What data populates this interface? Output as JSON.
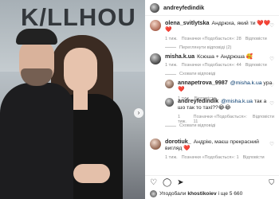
{
  "photo": {
    "sign_text": "K/LLHOU",
    "next_icon": "chevron-right-icon"
  },
  "post": {
    "author": "andreyfedindik"
  },
  "comments": [
    {
      "username": "olena_svitlytska",
      "text": "Андрюха, який ти ❤️❤️❤️",
      "meta": [
        "1 тиж.",
        "Позначки «Подобається»: 28",
        "Відповісти"
      ],
      "replies_toggle": "Переглянути відповіді (2)"
    },
    {
      "username": "misha.k.ua",
      "text": "Ксюша + Андрюша 🥰",
      "meta": [
        "1 тиж.",
        "Позначки «Подобається»: 44",
        "Відповісти"
      ],
      "replies_toggle": "Сховати відповіді"
    },
    {
      "username": "dorotiuk_",
      "text": "Андрію, маєш прекрасний вигляд ❤️",
      "meta": [
        "1 тиж.",
        "Позначки «Подобається»: 1",
        "Відповісти"
      ],
      "replies_toggle": ""
    }
  ],
  "replies": [
    {
      "username": "annapetrova_9987",
      "mention": "@misha.k.ua",
      "text": "ура❤️",
      "meta": [
        "1 тиж.",
        "Відповісти"
      ]
    },
    {
      "username": "andreyfedindik",
      "mention": "@misha.k.ua",
      "text": "так а шо так то тахі??😂😂",
      "meta": [
        "1 тиж.",
        "Позначки «Подобається»: 11",
        "Відповісти"
      ]
    }
  ],
  "replies_hide": "Сховати відповіді",
  "actions": {
    "icons": [
      "♡",
      "◯",
      "➤"
    ],
    "bookmark": "⛉",
    "likes_prefix": "Уподобали",
    "likes_user": "khostikoiev",
    "likes_suffix": "і ще 5 660"
  }
}
